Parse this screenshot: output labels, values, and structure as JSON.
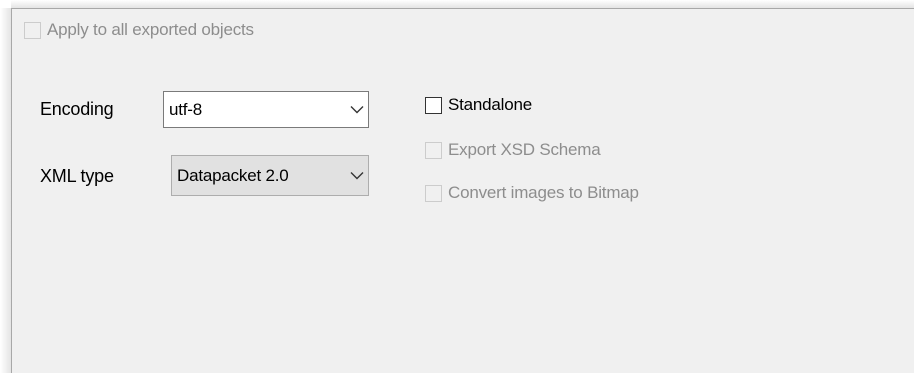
{
  "options": {
    "apply_all_label": "Apply to all exported objects",
    "apply_all_checked": false,
    "apply_all_enabled": false
  },
  "encoding": {
    "label": "Encoding",
    "value": "utf-8"
  },
  "xml_type": {
    "label": "XML type",
    "value": "Datapacket 2.0"
  },
  "checkboxes": {
    "standalone": {
      "label": "Standalone",
      "checked": false,
      "enabled": true
    },
    "export_xsd": {
      "label": "Export XSD Schema",
      "checked": false,
      "enabled": false
    },
    "convert_images": {
      "label": "Convert images to Bitmap",
      "checked": false,
      "enabled": false
    }
  },
  "icons": {
    "dropdown": "chevron-down-icon",
    "checkbox": "checkbox-icon"
  },
  "colors": {
    "panel_bg": "#f0f0f0",
    "disabled_text": "#8d8d8d",
    "readonly_combo_bg": "#e1e1e1"
  }
}
